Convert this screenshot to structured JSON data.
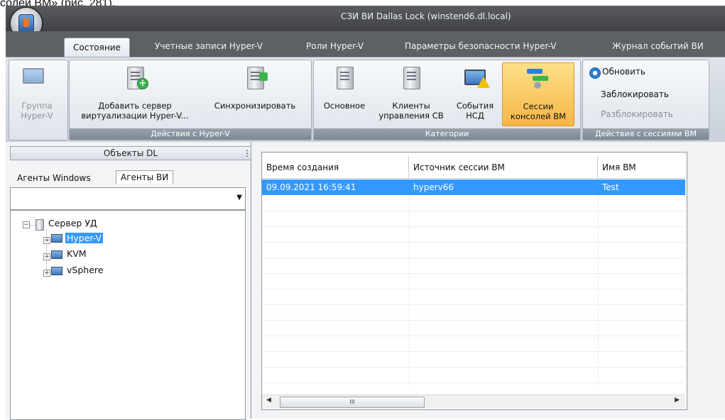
{
  "doc_caption": "солей ВМ» (рис. 281).",
  "window": {
    "title": "СЗИ ВИ Dallas Lock (winstend6.dl.local)"
  },
  "tabs": [
    {
      "label": "Состояние",
      "active": true
    },
    {
      "label": "Учетные записи Hyper-V"
    },
    {
      "label": "Роли Hyper-V"
    },
    {
      "label": "Параметры безопасности Hyper-V"
    },
    {
      "label": "Журнал событий ВИ"
    }
  ],
  "ribbon": {
    "group1": {
      "button": {
        "line1": "Группа",
        "line2": "Hyper-V",
        "icon": "monitor-group-icon"
      }
    },
    "group2": {
      "label": "Действия с Hyper-V",
      "add_server": {
        "line1": "Добавить сервер",
        "line2": "виртуализации Hyper-V...",
        "icon": "server-add-icon"
      },
      "sync": {
        "label": "Синхронизировать",
        "icon": "server-sync-icon"
      }
    },
    "group3": {
      "label": "Категории",
      "basic": {
        "label": "Основное",
        "icon": "server-gear-icon"
      },
      "clients": {
        "line1": "Клиенты",
        "line2": "управления СВ",
        "icon": "server-client-icon"
      },
      "events": {
        "line1": "События",
        "line2": "НСД",
        "icon": "monitor-warning-icon"
      },
      "sessions": {
        "line1": "Сессии",
        "line2": "консолей ВМ",
        "icon": "sessions-icon",
        "active": true
      }
    },
    "group4": {
      "label": "Действия с сессиями ВМ",
      "refresh": {
        "label": "Обновить",
        "icon": "refresh-icon"
      },
      "lock": {
        "label": "Заблокировать"
      },
      "unlock": {
        "label": "Разблокировать",
        "disabled": true
      }
    }
  },
  "left_panel": {
    "header": "Объекты DL",
    "grip": "⋮",
    "subtabs": [
      {
        "label": "Агенты Windows"
      },
      {
        "label": "Агенты ВИ",
        "active": true
      }
    ],
    "combo_value": "",
    "tree": {
      "root": {
        "label": "Сервер УД",
        "expander": "−"
      },
      "children": [
        {
          "label": "Hyper-V",
          "selected": true,
          "expander": "+"
        },
        {
          "label": "KVM",
          "expander": "+"
        },
        {
          "label": "vSphere",
          "expander": "+"
        }
      ]
    }
  },
  "table": {
    "columns": [
      "Время создания",
      "Источник сессии ВМ",
      "Имя ВМ"
    ],
    "rows": [
      {
        "time": "09.09.2021 16:59:41",
        "source": "hyperv66",
        "vm": "Test"
      }
    ],
    "scroll": {
      "left": "◀",
      "right": "▶",
      "thumb": "III"
    }
  },
  "colors": {
    "accent": "#3399ff",
    "active_button": "#f7b648",
    "chrome": "#3f4144"
  }
}
